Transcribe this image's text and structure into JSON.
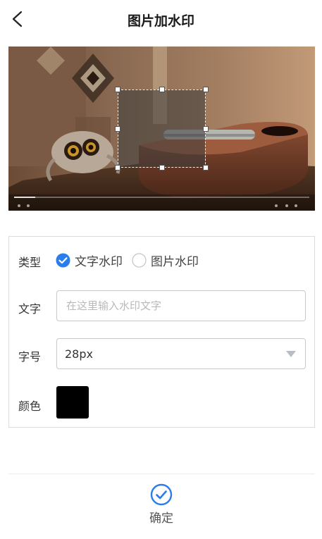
{
  "header": {
    "title": "图片加水印"
  },
  "form": {
    "type_label": "类型",
    "type_options": [
      {
        "label": "文字水印",
        "checked": true
      },
      {
        "label": "图片水印",
        "checked": false
      }
    ],
    "text_label": "文字",
    "text_value": "",
    "text_placeholder": "在这里输入水印文字",
    "size_label": "字号",
    "size_value": "28px",
    "color_label": "颜色",
    "color_value": "#000000"
  },
  "footer": {
    "confirm_label": "确定"
  },
  "colors": {
    "accent": "#2b7de9"
  }
}
